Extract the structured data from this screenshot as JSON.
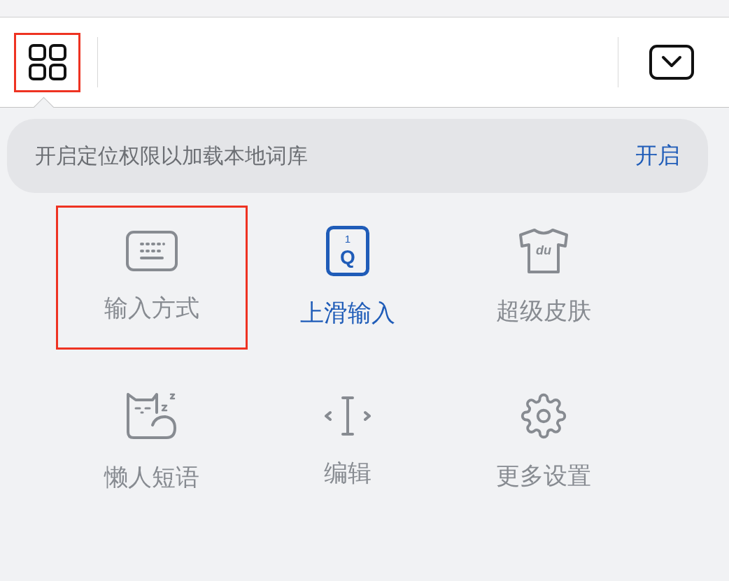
{
  "toolbar": {
    "menu_highlighted": true
  },
  "notice": {
    "text": "开启定位权限以加载本地词库",
    "action": "开启"
  },
  "items": [
    {
      "kind": "keyboard",
      "label": "输入方式",
      "selected": false,
      "highlighted": true
    },
    {
      "kind": "key",
      "label": "上滑输入",
      "selected": true,
      "highlighted": false,
      "icon_texts": [
        "1",
        "Q"
      ]
    },
    {
      "kind": "shirt",
      "label": "超级皮肤",
      "selected": false,
      "highlighted": false,
      "icon_texts": [
        "du"
      ]
    },
    {
      "kind": "cat",
      "label": "懒人短语",
      "selected": false,
      "highlighted": false
    },
    {
      "kind": "cursor",
      "label": "编辑",
      "selected": false,
      "highlighted": false
    },
    {
      "kind": "gear",
      "label": "更多设置",
      "selected": false,
      "highlighted": false
    }
  ]
}
